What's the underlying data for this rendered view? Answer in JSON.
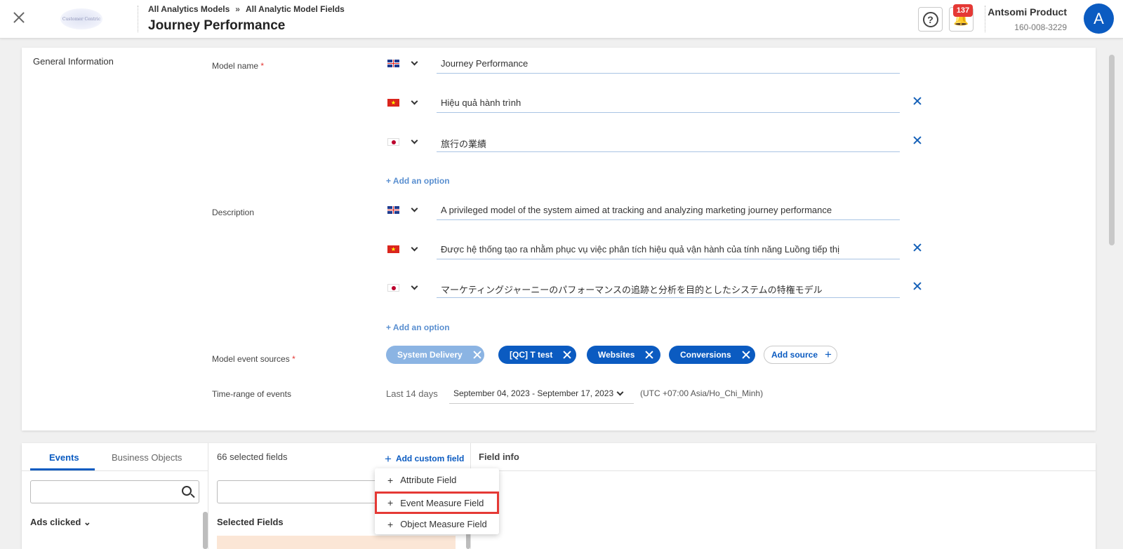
{
  "header": {
    "breadcrumbs": [
      "All Analytics Models",
      "All Analytic Model Fields"
    ],
    "breadcrumb_separator": "»",
    "title": "Journey Performance",
    "logo_text": "Customer Centric",
    "notification_count": "137",
    "help_label": "?",
    "bell_label": "🔔",
    "user_name": "Antsomi Product",
    "user_phone": "160-008-3229",
    "avatar_letter": "A",
    "avatar_color": "#0b5bc1"
  },
  "general": {
    "section_title": "General Information",
    "model_name_label": "Model name",
    "description_label": "Description",
    "event_sources_label": "Model event sources",
    "time_range_label": "Time-range of events",
    "required_mark": "*",
    "model_names": [
      {
        "lang": "uk-flag",
        "value": "Journey Performance"
      },
      {
        "lang": "vn-flag",
        "value": "Hiệu quả hành trình"
      },
      {
        "lang": "jp-flag",
        "value": "旅行の業績"
      }
    ],
    "descriptions": [
      {
        "lang": "uk-flag",
        "value": "A privileged model of the system aimed at tracking and analyzing marketing journey performance"
      },
      {
        "lang": "vn-flag",
        "value": "Được hệ thống tạo ra nhằm phục vụ việc phân tích hiệu quả vận hành của tính năng Luồng tiếp thị"
      },
      {
        "lang": "jp-flag",
        "value": "マーケティングジャーニーのパフォーマンスの追跡と分析を目的としたシステムの特権モデル"
      }
    ],
    "add_option_label": "+ Add an option",
    "sources": [
      "System Delivery",
      "[QC] T test",
      "Websites",
      "Conversions"
    ],
    "add_source_label": "Add source",
    "time_range_preset": "Last 14 days",
    "date_range": "September 04, 2023 - September 17, 2023",
    "timezone": "(UTC +07:00 Asia/Ho_Chi_Minh)",
    "vn_flag_star": "★"
  },
  "bottom": {
    "tabs": [
      "Events",
      "Business Objects"
    ],
    "active_tab": "Events",
    "event_group": "Ads clicked",
    "selected_count": "66 selected fields",
    "add_custom_label": "Add custom field",
    "selected_fields_label": "Selected Fields",
    "field_info_label": "Field info"
  },
  "custom_field_menu": {
    "items": [
      "Attribute Field",
      "Event Measure Field",
      "Object Measure Field"
    ],
    "highlighted": "Event Measure Field"
  }
}
